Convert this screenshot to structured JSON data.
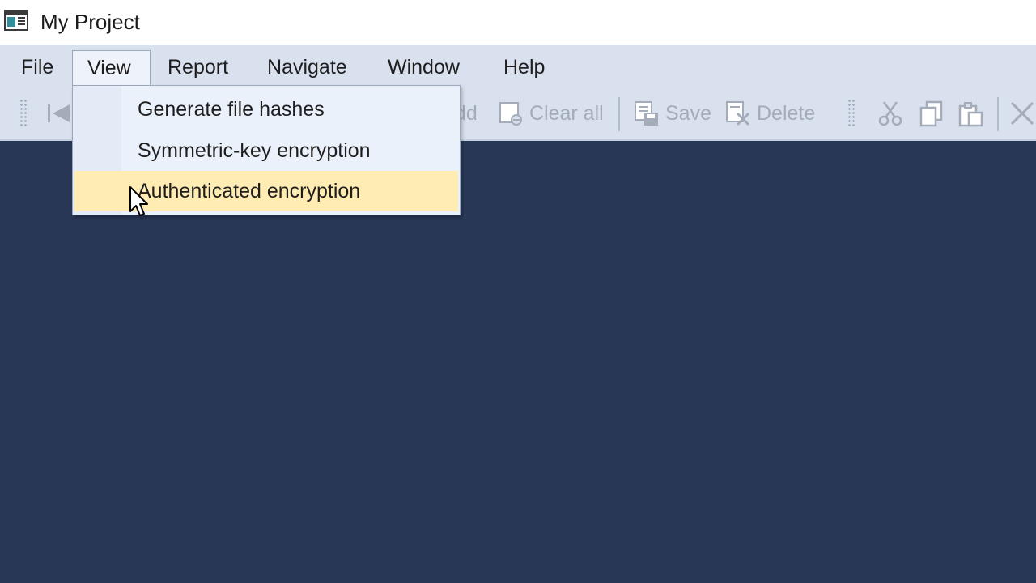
{
  "window": {
    "title": "My Project"
  },
  "menubar": {
    "items": [
      {
        "label": "File"
      },
      {
        "label": "View"
      },
      {
        "label": "Report"
      },
      {
        "label": "Navigate"
      },
      {
        "label": "Window"
      },
      {
        "label": "Help"
      }
    ],
    "active": "View"
  },
  "toolbar": {
    "add_label": "dd",
    "clear_all_label": "Clear all",
    "save_label": "Save",
    "delete_label": "Delete"
  },
  "view_menu": {
    "items": [
      {
        "label": "Generate file hashes"
      },
      {
        "label": "Symmetric-key encryption"
      },
      {
        "label": "Authenticated encryption"
      }
    ],
    "hovered": "Authenticated encryption"
  },
  "colors": {
    "menubar": "#d9e1ef",
    "workspace": "#283756",
    "hover": "#ffecb3",
    "disabled_text": "#a4acba"
  },
  "icons": {
    "app": "window-app-icon",
    "first": "skip-first-icon",
    "add": "add-icon",
    "clear_all": "clear-all-icon",
    "save": "save-icon",
    "delete": "delete-icon",
    "cut": "scissors-icon",
    "copy": "copy-icon",
    "paste": "paste-icon",
    "close": "close-icon"
  }
}
